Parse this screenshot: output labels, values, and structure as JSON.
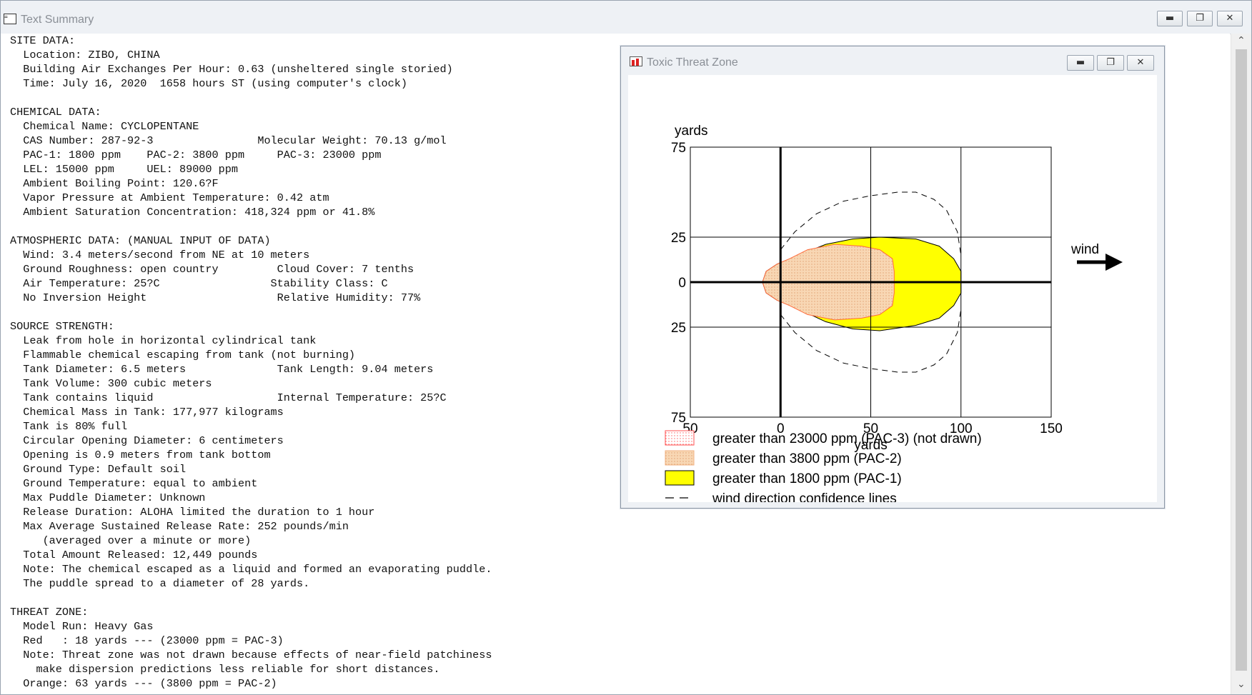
{
  "main_window": {
    "title": "Text Summary",
    "icon": "text-document-icon",
    "buttons": {
      "minimize": "minimize-icon",
      "restore": "restore-icon",
      "close": "close-icon"
    }
  },
  "summary_lines": [
    "SITE DATA:",
    "  Location: ZIBO, CHINA",
    "  Building Air Exchanges Per Hour: 0.63 (unsheltered single storied)",
    "  Time: July 16, 2020  1658 hours ST (using computer's clock)",
    "",
    "CHEMICAL DATA:",
    "  Chemical Name: CYCLOPENTANE",
    "  CAS Number: 287-92-3                Molecular Weight: 70.13 g/mol",
    "  PAC-1: 1800 ppm    PAC-2: 3800 ppm     PAC-3: 23000 ppm",
    "  LEL: 15000 ppm     UEL: 89000 ppm",
    "  Ambient Boiling Point: 120.6?F",
    "  Vapor Pressure at Ambient Temperature: 0.42 atm",
    "  Ambient Saturation Concentration: 418,324 ppm or 41.8%",
    "",
    "ATMOSPHERIC DATA: (MANUAL INPUT OF DATA)",
    "  Wind: 3.4 meters/second from NE at 10 meters",
    "  Ground Roughness: open country         Cloud Cover: 7 tenths",
    "  Air Temperature: 25?C                 Stability Class: C",
    "  No Inversion Height                    Relative Humidity: 77%",
    "",
    "SOURCE STRENGTH:",
    "  Leak from hole in horizontal cylindrical tank",
    "  Flammable chemical escaping from tank (not burning)",
    "  Tank Diameter: 6.5 meters              Tank Length: 9.04 meters",
    "  Tank Volume: 300 cubic meters",
    "  Tank contains liquid                   Internal Temperature: 25?C",
    "  Chemical Mass in Tank: 177,977 kilograms",
    "  Tank is 80% full",
    "  Circular Opening Diameter: 6 centimeters",
    "  Opening is 0.9 meters from tank bottom",
    "  Ground Type: Default soil",
    "  Ground Temperature: equal to ambient",
    "  Max Puddle Diameter: Unknown",
    "  Release Duration: ALOHA limited the duration to 1 hour",
    "  Max Average Sustained Release Rate: 252 pounds/min",
    "     (averaged over a minute or more)",
    "  Total Amount Released: 12,449 pounds",
    "  Note: The chemical escaped as a liquid and formed an evaporating puddle.",
    "  The puddle spread to a diameter of 28 yards.",
    "",
    "THREAT ZONE:",
    "  Model Run: Heavy Gas",
    "  Red   : 18 yards --- (23000 ppm = PAC-3)",
    "  Note: Threat zone was not drawn because effects of near-field patchiness",
    "    make dispersion predictions less reliable for short distances.",
    "  Orange: 63 yards --- (3800 ppm = PAC-2)"
  ],
  "threat_window": {
    "title": "Toxic Threat Zone",
    "icon": "threat-zone-icon",
    "buttons": {
      "minimize": "minimize-icon",
      "restore": "restore-icon",
      "close": "close-icon"
    },
    "chart_data": {
      "type": "area",
      "y_unit_label": "yards",
      "x_unit_label": "yards",
      "x_ticks": [
        "50",
        "0",
        "50",
        "100",
        "150"
      ],
      "y_ticks": [
        "75",
        "25",
        "0",
        "25",
        "75"
      ],
      "x_range": [
        -50,
        150
      ],
      "y_range": [
        -75,
        75
      ],
      "grid": true,
      "wind_label": "wind",
      "colors": {
        "pac1": "#ffff00",
        "pac2": "#f8d7b4",
        "pac3_border": "#ff5050",
        "outline": "#000000"
      },
      "pac2_zone": [
        [
          -10,
          0
        ],
        [
          -8,
          6
        ],
        [
          -2,
          10
        ],
        [
          5,
          13
        ],
        [
          15,
          18
        ],
        [
          30,
          21
        ],
        [
          45,
          20
        ],
        [
          55,
          18
        ],
        [
          62,
          13
        ],
        [
          63,
          6
        ],
        [
          63,
          -6
        ],
        [
          62,
          -13
        ],
        [
          55,
          -18
        ],
        [
          45,
          -20
        ],
        [
          30,
          -21
        ],
        [
          15,
          -18
        ],
        [
          5,
          -13
        ],
        [
          -2,
          -10
        ],
        [
          -8,
          -6
        ]
      ],
      "pac1_zone": [
        [
          -10,
          0
        ],
        [
          -8,
          6
        ],
        [
          -2,
          10
        ],
        [
          10,
          15
        ],
        [
          25,
          21
        ],
        [
          40,
          24
        ],
        [
          55,
          25
        ],
        [
          75,
          24
        ],
        [
          88,
          20
        ],
        [
          96,
          13
        ],
        [
          100,
          6
        ],
        [
          100,
          -6
        ],
        [
          96,
          -13
        ],
        [
          88,
          -20
        ],
        [
          75,
          -24
        ],
        [
          55,
          -27
        ],
        [
          40,
          -26
        ],
        [
          25,
          -22
        ],
        [
          10,
          -15
        ],
        [
          -2,
          -10
        ],
        [
          -8,
          -6
        ]
      ],
      "confidence_upper": [
        [
          0,
          18
        ],
        [
          8,
          28
        ],
        [
          20,
          38
        ],
        [
          35,
          45
        ],
        [
          50,
          48
        ],
        [
          65,
          50
        ],
        [
          75,
          50
        ],
        [
          85,
          46
        ],
        [
          92,
          40
        ],
        [
          98,
          28
        ],
        [
          100,
          15
        ]
      ],
      "confidence_lower": [
        [
          0,
          -18
        ],
        [
          8,
          -28
        ],
        [
          20,
          -38
        ],
        [
          35,
          -45
        ],
        [
          50,
          -48
        ],
        [
          65,
          -50
        ],
        [
          75,
          -50
        ],
        [
          85,
          -46
        ],
        [
          92,
          -40
        ],
        [
          98,
          -28
        ],
        [
          100,
          -15
        ]
      ],
      "legend": [
        {
          "label": "greater than 23000 ppm (PAC-3) (not drawn)",
          "swatch": "pac3"
        },
        {
          "label": "greater than 3800 ppm (PAC-2)",
          "swatch": "pac2"
        },
        {
          "label": "greater than 1800 ppm (PAC-1)",
          "swatch": "pac1"
        },
        {
          "label": "wind direction confidence lines",
          "swatch": "dash"
        }
      ]
    }
  }
}
